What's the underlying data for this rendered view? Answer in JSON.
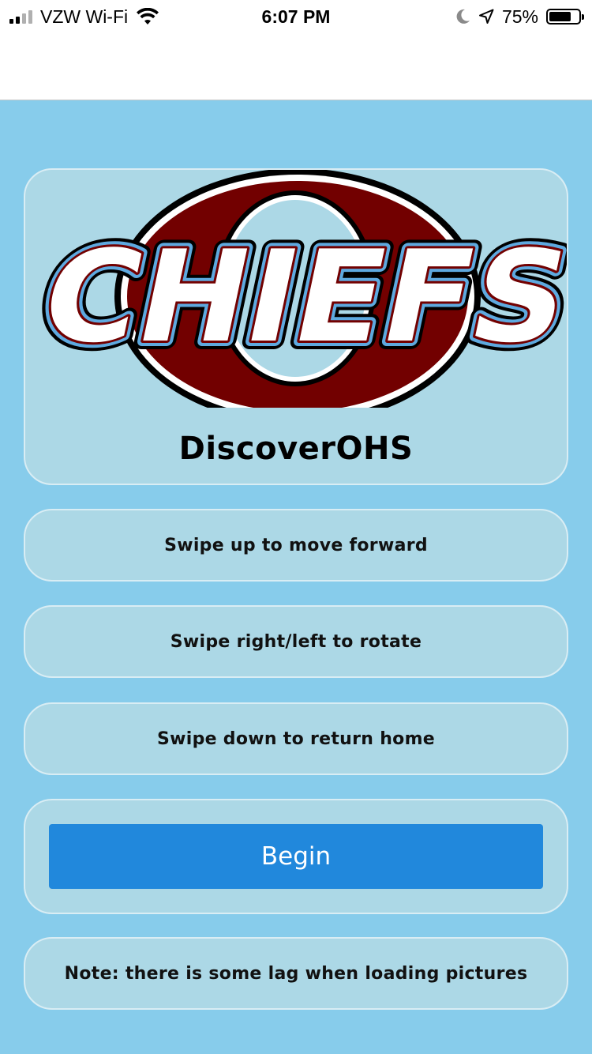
{
  "status_bar": {
    "carrier": "VZW Wi-Fi",
    "time": "6:07 PM",
    "battery_percent": "75%",
    "battery_level": 0.75,
    "signal_bars_filled": 2,
    "icons": [
      "wifi-icon",
      "moon-icon",
      "location-arrow-icon",
      "battery-icon"
    ]
  },
  "hero": {
    "logo_text": "CHIEFS",
    "title": "DiscoverOHS"
  },
  "instructions": [
    {
      "label": "Swipe up to move forward"
    },
    {
      "label": "Swipe right/left to rotate"
    },
    {
      "label": "Swipe down to return home"
    }
  ],
  "begin": {
    "label": "Begin"
  },
  "note": {
    "label": "Note: there is some lag when loading pictures"
  },
  "colors": {
    "background": "#87cceb",
    "card": "#acd8e6",
    "button": "#2188dc",
    "logo_maroon": "#720000",
    "logo_blue": "#5ea9df"
  }
}
